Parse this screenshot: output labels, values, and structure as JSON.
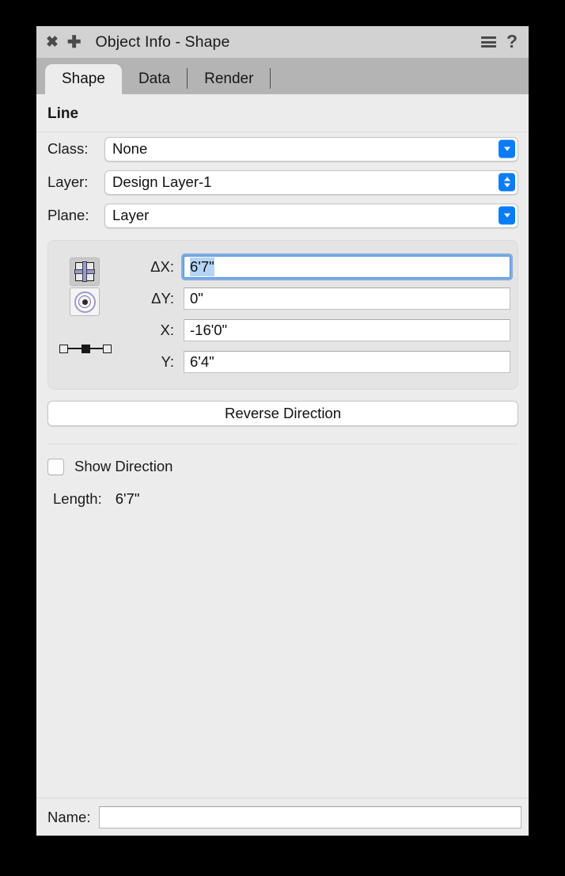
{
  "window": {
    "title": "Object Info - Shape",
    "close_icon": "close-icon",
    "add_icon": "plus-icon",
    "menu_icon": "hamburger-menu-icon",
    "help_icon": "question-mark-icon"
  },
  "tabs": [
    {
      "label": "Shape",
      "active": true
    },
    {
      "label": "Data",
      "active": false
    },
    {
      "label": "Render",
      "active": false
    }
  ],
  "shape": {
    "section_title": "Line",
    "fields": [
      {
        "label": "Class:",
        "value": "None",
        "control": "popup"
      },
      {
        "label": "Layer:",
        "value": "Design Layer-1",
        "control": "stepper"
      },
      {
        "label": "Plane:",
        "value": "Layer",
        "control": "popup"
      }
    ],
    "coordinates": [
      {
        "label": "ΔX:",
        "value": "6'7\"",
        "focused": true,
        "selected": true
      },
      {
        "label": "ΔY:",
        "value": "0\"",
        "focused": false,
        "selected": false
      },
      {
        "label": "X:",
        "value": "-16'0\"",
        "focused": false,
        "selected": false
      },
      {
        "label": "Y:",
        "value": "6'4\"",
        "focused": false,
        "selected": false
      }
    ],
    "datum_icon": "line-midpoint-datum-icon",
    "grid_button_icon": "grid-quadrant-icon",
    "center_button_icon": "center-target-icon",
    "reverse_button": "Reverse Direction",
    "show_direction": {
      "label": "Show Direction",
      "checked": false
    },
    "length": {
      "label": "Length:",
      "value": "6'7\""
    }
  },
  "footer": {
    "name_label": "Name:",
    "name_value": "",
    "name_placeholder": ""
  },
  "colors": {
    "accent_blue": "#0b7cf7",
    "focus_ring": "#4a8fe0",
    "selection": "#b4d5f5",
    "panel_bg": "#ececec",
    "titlebar_bg": "#d2d2d2",
    "tabbar_bg": "#b4b4b4"
  }
}
